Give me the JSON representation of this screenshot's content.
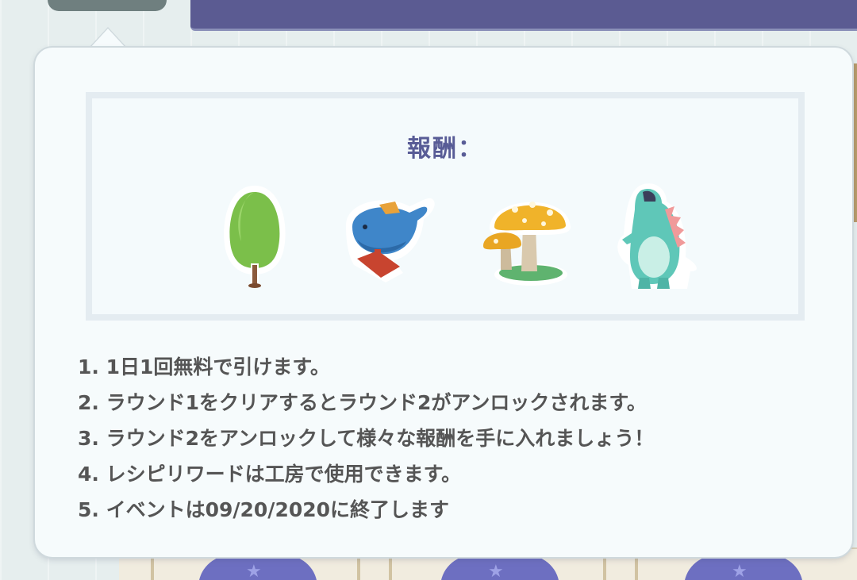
{
  "reward_panel": {
    "title": "報酬：",
    "items": [
      {
        "icon": "tree-icon",
        "color": "#7bbf4a"
      },
      {
        "icon": "whale-icon",
        "color": "#3f86c9"
      },
      {
        "icon": "mushroom-icon",
        "color": "#f0b32a"
      },
      {
        "icon": "dinosaur-icon",
        "color": "#5fc7b8"
      }
    ]
  },
  "rules": [
    "1. 1日1回無料で引けます。",
    "2. ラウンド1をクリアするとラウンド2がアンロックされます。",
    "3. ラウンド2をアンロックして様々な報酬を手に入れましょう！",
    "4. レシピリワードは工房で使用できます。",
    "5. イベントは09/20/2020に終了します"
  ],
  "colors": {
    "title": "#585c96",
    "banner": "#5b5b92",
    "panel": "#f6fbfc",
    "text": "#555555"
  }
}
